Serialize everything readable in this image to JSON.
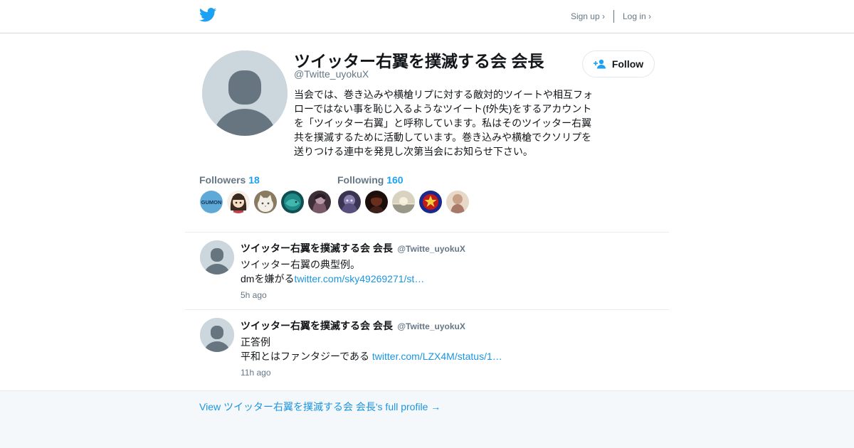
{
  "header": {
    "logo_icon": "twitter-bird-icon",
    "signup_label": "Sign up ›",
    "login_label": "Log in ›"
  },
  "profile": {
    "name": "ツイッター右翼を撲滅する会 会長",
    "handle": "@Twitte_uyokuX",
    "bio": "当会では、巻き込みや横槍リプに対する敵対的ツイートや相互フォローではない事を恥じ入るようなツイート(f外失)をするアカウントを「ツイッター右翼」と呼称しています。私はそのツイッター右翼共を撲滅するために活動しています。巻き込みや横槍でクソリプを送りつける連中を発見し次第当会にお知らせ下さい。",
    "follow_label": "Follow",
    "follow_icon": "add-user-icon"
  },
  "followers": {
    "label": "Followers",
    "count": "18",
    "avatars": [
      {
        "icon": "gumon-logo-avatar",
        "color": "#5fa9d9"
      },
      {
        "icon": "anime-girl-avatar",
        "color": "#f0e0c8"
      },
      {
        "icon": "white-cat-avatar",
        "color": "#d8d0c0"
      },
      {
        "icon": "teal-fish-avatar",
        "color": "#1f7a78"
      },
      {
        "icon": "dark-portrait-avatar",
        "color": "#5a4a50"
      }
    ]
  },
  "following": {
    "label": "Following",
    "count": "160",
    "avatars": [
      {
        "icon": "purple-character-avatar",
        "color": "#4d4560"
      },
      {
        "icon": "dark-portrait-avatar",
        "color": "#3a1a12"
      },
      {
        "icon": "sunset-sea-avatar",
        "color": "#d8d0b8"
      },
      {
        "icon": "red-blue-emblem-avatar",
        "color": "#1a2a8a"
      },
      {
        "icon": "beige-figure-avatar",
        "color": "#d8b8a0"
      }
    ]
  },
  "tweets": [
    {
      "name": "ツイッター右翼を撲滅する会 会長",
      "handle": "@Twitte_uyokuX",
      "line1": "ツイッター右翼の典型例。",
      "line2_text": "dmを嫌がる",
      "line2_link": "twitter.com/sky49269271/st…",
      "time": "5h ago"
    },
    {
      "name": "ツイッター右翼を撲滅する会 会長",
      "handle": "@Twitte_uyokuX",
      "line1": "正答例",
      "line2_text": "平和とはファンタジーである ",
      "line2_link": "twitter.com/LZX4M/status/1…",
      "time": "11h ago"
    }
  ],
  "footer": {
    "link_label": "View ツイッター右翼を撲滅する会 会長's full profile →"
  }
}
